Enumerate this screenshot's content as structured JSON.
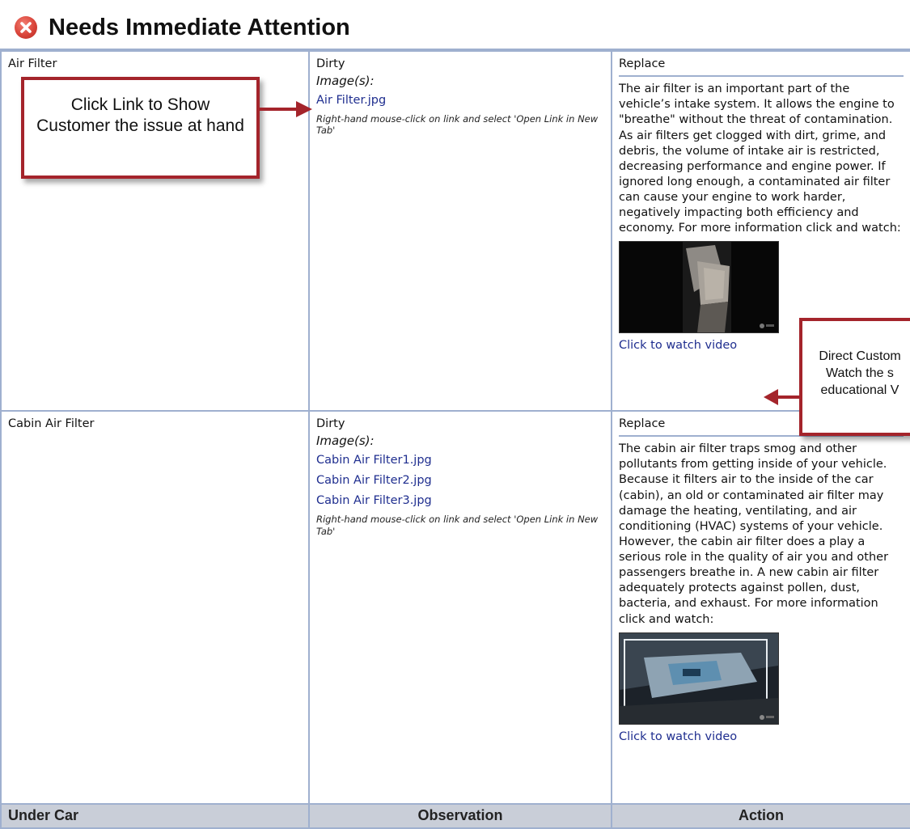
{
  "header": {
    "title": "Needs Immediate Attention",
    "icon": "alert-x-icon",
    "icon_color": "#d9443a"
  },
  "rows": [
    {
      "item": "Air Filter",
      "observation": "Dirty",
      "images_label": "Image(s):",
      "image_links": [
        "Air Filter.jpg"
      ],
      "hint": "Right-hand mouse-click on link and select 'Open Link in New Tab'",
      "action": "Replace",
      "description": "The air filter is an important part of the vehicle’s intake system. It allows the engine to \"breathe\" without the threat of contamination. As air filters get clogged with dirt, grime, and debris, the volume of intake air is restricted, decreasing performance and engine power. If ignored long enough, a contaminated air filter can cause your engine to work harder, negatively impacting both efficiency and economy. For more information click and watch:",
      "video_link": "Click to watch video"
    },
    {
      "item": "Cabin Air Filter",
      "observation": "Dirty",
      "images_label": "Image(s):",
      "image_links": [
        "Cabin Air Filter1.jpg",
        "Cabin Air Filter2.jpg",
        "Cabin Air Filter3.jpg"
      ],
      "hint": "Right-hand mouse-click on link and select 'Open Link in New Tab'",
      "action": "Replace",
      "description": "The cabin air filter traps smog and other pollutants from getting inside of your vehicle. Because it filters air to the inside of the car (cabin), an old or contaminated air filter may damage the heating, ventilating, and air conditioning (HVAC) systems of your vehicle. However, the cabin air filter does a play a serious role in the quality of air you and other passengers breathe in. A new cabin air filter adequately protects against pollen, dust, bacteria, and exhaust. For more information click and watch:",
      "video_link": "Click to watch video"
    }
  ],
  "footer": {
    "col1": "Under Car",
    "col2": "Observation",
    "col3": "Action"
  },
  "callouts": {
    "link_tip": "Click Link to Show Customer the issue at hand",
    "video_tip_lines": [
      "Direct Custom",
      "Watch the s",
      "educational V"
    ]
  },
  "colors": {
    "grid": "#9fb0cf",
    "link": "#1f2e8f",
    "callout_border": "#a4242b",
    "footer_bg": "#c9ced8"
  }
}
